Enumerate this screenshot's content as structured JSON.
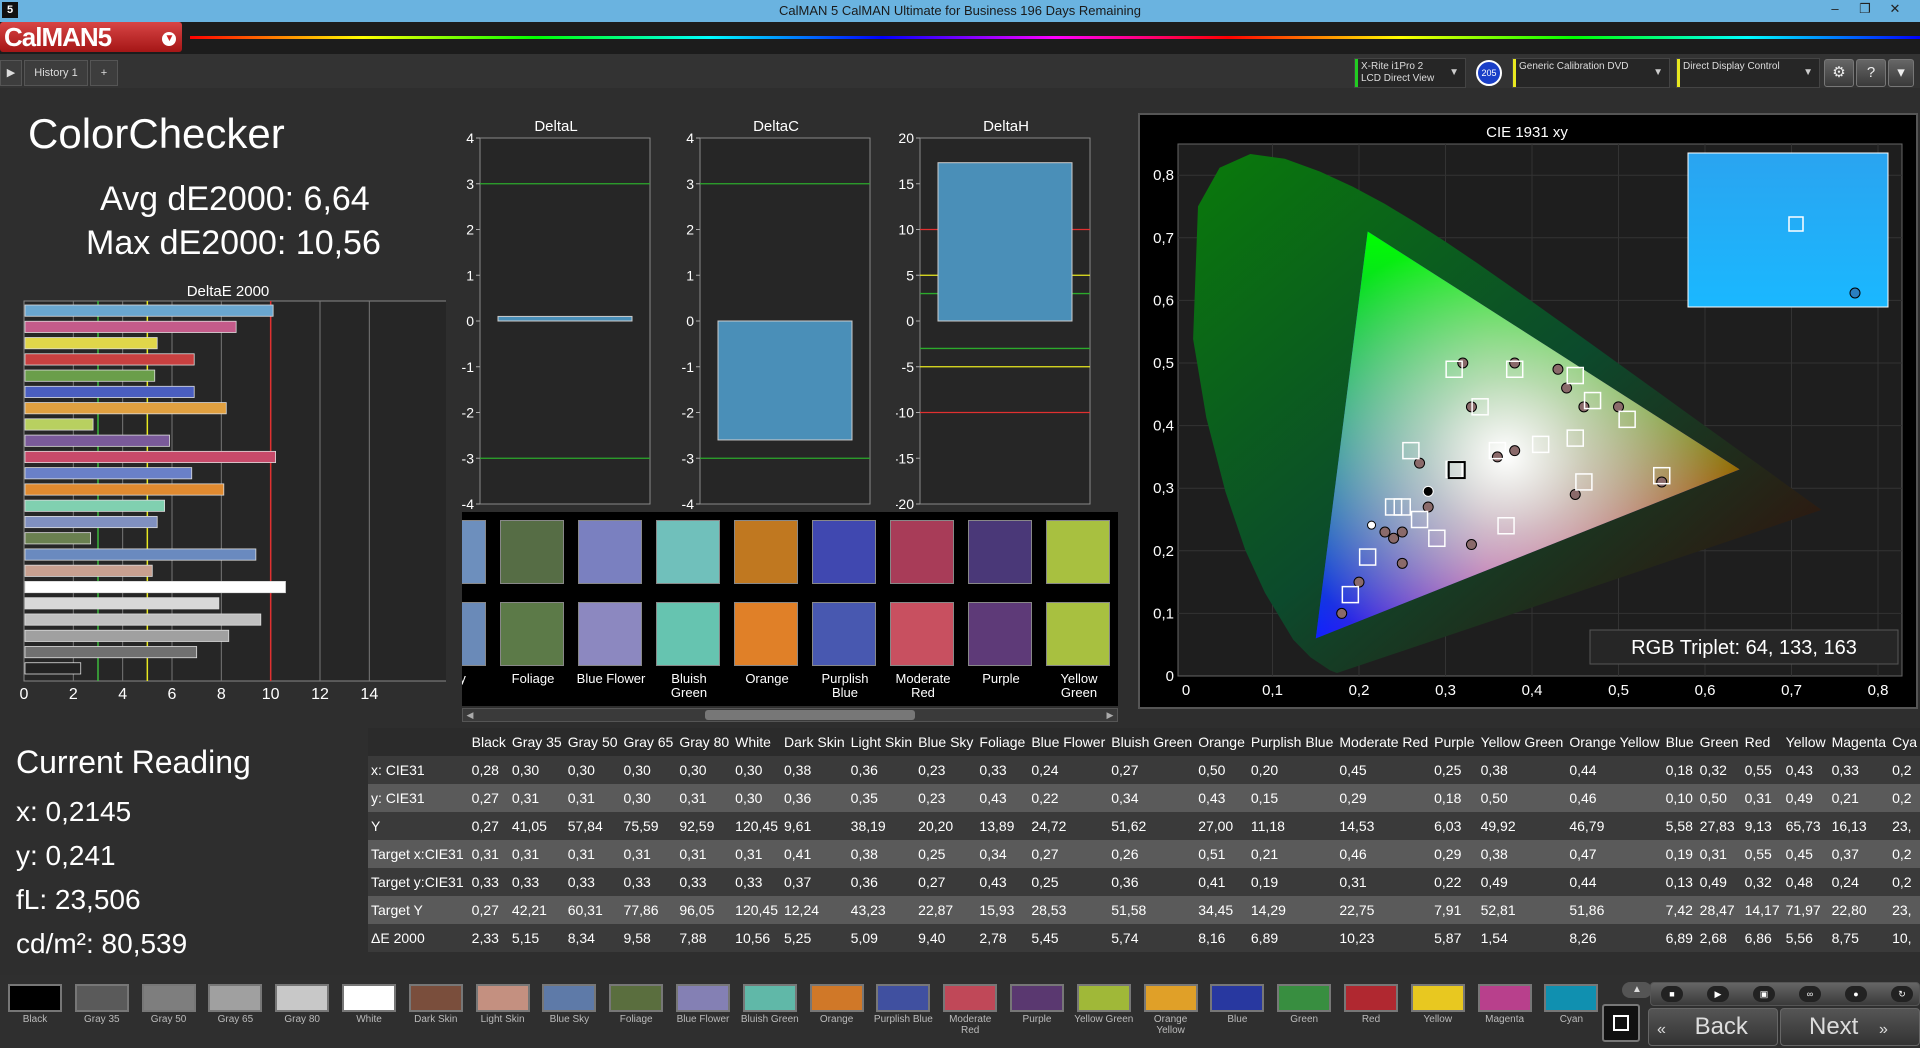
{
  "window": {
    "title": "CalMAN 5 CalMAN Ultimate for Business 196 Days Remaining",
    "icon": "5"
  },
  "app": {
    "logo": "CalMAN5",
    "tab": "History 1",
    "tab_add": "+"
  },
  "devices": {
    "meter": {
      "line1": "X-Rite i1Pro 2",
      "line2": "LCD Direct View",
      "badge": "205",
      "accent": "#22cc22"
    },
    "source": {
      "line1": "Generic Calibration DVD",
      "accent": "#e8e820"
    },
    "display": {
      "line1": "Direct Display Control",
      "accent": "#e8e820"
    }
  },
  "summary": {
    "title": "ColorChecker",
    "avg": "Avg dE2000: 6,64",
    "max": "Max dE2000: 10,56"
  },
  "deltae_chart": {
    "title": "DeltaE 2000",
    "ticks": [
      "0",
      "2",
      "4",
      "6",
      "8",
      "10",
      "12",
      "14"
    ],
    "values": [
      10.1,
      8.6,
      5.4,
      6.9,
      5.3,
      6.9,
      8.2,
      2.8,
      5.9,
      10.2,
      6.8,
      8.1,
      5.7,
      5.4,
      2.7,
      9.4,
      5.2,
      10.6,
      7.9,
      9.6,
      8.3,
      7.0,
      2.3
    ],
    "colors": [
      "#6aa7d0",
      "#c45b8a",
      "#e0d64a",
      "#c84040",
      "#6a9e4a",
      "#4a5ec0",
      "#e0a040",
      "#b8d060",
      "#7a5a9a",
      "#c84a6a",
      "#6a80c8",
      "#e08a30",
      "#80d0b0",
      "#8090c0",
      "#6a8050",
      "#6a8abf",
      "#c8a090",
      "#ffffff",
      "#d8d8d8",
      "#c0c0c0",
      "#a0a0a0",
      "#707070",
      "#222222"
    ],
    "lines": {
      "green": 3,
      "yellow": 5,
      "red": 10
    }
  },
  "deltaL": {
    "title": "DeltaL",
    "ticks": [
      "4",
      "3",
      "2",
      "1",
      "0",
      "-1",
      "-2",
      "-3",
      "-4"
    ],
    "value": 0.1
  },
  "deltaC": {
    "title": "DeltaC",
    "ticks": [
      "4",
      "3",
      "2",
      "1",
      "0",
      "-1",
      "-2",
      "-3",
      "-4"
    ],
    "value": -2.6
  },
  "deltaH": {
    "title": "DeltaH",
    "ticks": [
      "20",
      "15",
      "10",
      "5",
      "0",
      "-5",
      "-10",
      "-15",
      "-20"
    ],
    "value": 17.3
  },
  "swatch_strip": {
    "items": [
      {
        "name": "Sky",
        "actual": "#6d8fbd",
        "target": "#6a8ab8"
      },
      {
        "name": "Foliage",
        "actual": "#566d45",
        "target": "#5c7a48"
      },
      {
        "name": "Blue Flower",
        "actual": "#7a80c0",
        "target": "#8c88c0"
      },
      {
        "name": "Bluish Green",
        "actual": "#70c0bb",
        "target": "#66c4b0"
      },
      {
        "name": "Orange",
        "actual": "#c07820",
        "target": "#e08028"
      },
      {
        "name": "Purplish Blue",
        "actual": "#4048b0",
        "target": "#4858b0"
      },
      {
        "name": "Moderate Red",
        "actual": "#a83c58",
        "target": "#c85060"
      },
      {
        "name": "Purple",
        "actual": "#4a3878",
        "target": "#5e3a78"
      },
      {
        "name": "Yellow Green",
        "actual": "#a8c040",
        "target": "#a8c040"
      }
    ]
  },
  "cie": {
    "title": "CIE 1931 xy",
    "rgb_triplet": "RGB Triplet: 64, 133, 163",
    "xticks": [
      "0",
      "0,1",
      "0,2",
      "0,3",
      "0,4",
      "0,5",
      "0,6",
      "0,7",
      "0,8"
    ],
    "yticks": [
      "0,1",
      "0,2",
      "0,3",
      "0,4",
      "0,5",
      "0,6",
      "0,7",
      "0,8"
    ],
    "y_zero": "0",
    "targets": [
      [
        0.31,
        0.33
      ],
      [
        0.41,
        0.37
      ],
      [
        0.36,
        0.36
      ],
      [
        0.25,
        0.27
      ],
      [
        0.34,
        0.43
      ],
      [
        0.27,
        0.25
      ],
      [
        0.26,
        0.36
      ],
      [
        0.51,
        0.41
      ],
      [
        0.21,
        0.19
      ],
      [
        0.46,
        0.31
      ],
      [
        0.29,
        0.22
      ],
      [
        0.38,
        0.49
      ],
      [
        0.47,
        0.44
      ],
      [
        0.19,
        0.13
      ],
      [
        0.31,
        0.49
      ],
      [
        0.55,
        0.32
      ],
      [
        0.45,
        0.48
      ],
      [
        0.37,
        0.24
      ],
      [
        0.24,
        0.27
      ],
      [
        0.45,
        0.38
      ]
    ],
    "measured": [
      [
        0.28,
        0.27
      ],
      [
        0.38,
        0.36
      ],
      [
        0.36,
        0.35
      ],
      [
        0.23,
        0.23
      ],
      [
        0.33,
        0.43
      ],
      [
        0.24,
        0.22
      ],
      [
        0.27,
        0.34
      ],
      [
        0.5,
        0.43
      ],
      [
        0.2,
        0.15
      ],
      [
        0.45,
        0.29
      ],
      [
        0.25,
        0.18
      ],
      [
        0.38,
        0.5
      ],
      [
        0.44,
        0.46
      ],
      [
        0.18,
        0.1
      ],
      [
        0.32,
        0.5
      ],
      [
        0.55,
        0.31
      ],
      [
        0.43,
        0.49
      ],
      [
        0.33,
        0.21
      ],
      [
        0.25,
        0.23
      ],
      [
        0.46,
        0.43
      ]
    ],
    "current": [
      0.2145,
      0.241
    ]
  },
  "current_reading": {
    "title": "Current Reading",
    "x": "x: 0,2145",
    "y": "y: 0,241",
    "fl": "fL: 23,506",
    "cdm2": "cd/m²: 80,539"
  },
  "table": {
    "columns": [
      "",
      "Black",
      "Gray 35",
      "Gray 50",
      "Gray 65",
      "Gray 80",
      "White",
      "Dark Skin",
      "Light Skin",
      "Blue Sky",
      "Foliage",
      "Blue Flower",
      "Bluish Green",
      "Orange",
      "Purplish Blue",
      "Moderate Red",
      "Purple",
      "Yellow Green",
      "Orange Yellow",
      "Blue",
      "Green",
      "Red",
      "Yellow",
      "Magenta",
      "Cya"
    ],
    "rows": [
      [
        "x: CIE31",
        "0,28",
        "0,30",
        "0,30",
        "0,30",
        "0,30",
        "0,30",
        "0,38",
        "0,36",
        "0,23",
        "0,33",
        "0,24",
        "0,27",
        "0,50",
        "0,20",
        "0,45",
        "0,25",
        "0,38",
        "0,44",
        "0,18",
        "0,32",
        "0,55",
        "0,43",
        "0,33",
        "0,2"
      ],
      [
        "y: CIE31",
        "0,27",
        "0,31",
        "0,31",
        "0,30",
        "0,31",
        "0,30",
        "0,36",
        "0,35",
        "0,23",
        "0,43",
        "0,22",
        "0,34",
        "0,43",
        "0,15",
        "0,29",
        "0,18",
        "0,50",
        "0,46",
        "0,10",
        "0,50",
        "0,31",
        "0,49",
        "0,21",
        "0,2"
      ],
      [
        "Y",
        "0,27",
        "41,05",
        "57,84",
        "75,59",
        "92,59",
        "120,45",
        "9,61",
        "38,19",
        "20,20",
        "13,89",
        "24,72",
        "51,62",
        "27,00",
        "11,18",
        "14,53",
        "6,03",
        "49,92",
        "46,79",
        "5,58",
        "27,83",
        "9,13",
        "65,73",
        "16,13",
        "23,"
      ],
      [
        "Target x:CIE31",
        "0,31",
        "0,31",
        "0,31",
        "0,31",
        "0,31",
        "0,31",
        "0,41",
        "0,38",
        "0,25",
        "0,34",
        "0,27",
        "0,26",
        "0,51",
        "0,21",
        "0,46",
        "0,29",
        "0,38",
        "0,47",
        "0,19",
        "0,31",
        "0,55",
        "0,45",
        "0,37",
        "0,2"
      ],
      [
        "Target y:CIE31",
        "0,33",
        "0,33",
        "0,33",
        "0,33",
        "0,33",
        "0,33",
        "0,37",
        "0,36",
        "0,27",
        "0,43",
        "0,25",
        "0,36",
        "0,41",
        "0,19",
        "0,31",
        "0,22",
        "0,49",
        "0,44",
        "0,13",
        "0,49",
        "0,32",
        "0,48",
        "0,24",
        "0,2"
      ],
      [
        "Target Y",
        "0,27",
        "42,21",
        "60,31",
        "77,86",
        "96,05",
        "120,45",
        "12,24",
        "43,23",
        "22,87",
        "15,93",
        "28,53",
        "51,58",
        "34,45",
        "14,29",
        "22,75",
        "7,91",
        "52,81",
        "51,86",
        "7,42",
        "28,47",
        "14,17",
        "71,97",
        "22,80",
        "23,"
      ],
      [
        "ΔE 2000",
        "2,33",
        "5,15",
        "8,34",
        "9,58",
        "7,88",
        "10,56",
        "5,25",
        "5,09",
        "9,40",
        "2,78",
        "5,45",
        "5,74",
        "8,16",
        "6,89",
        "10,23",
        "5,87",
        "1,54",
        "8,26",
        "6,89",
        "2,68",
        "6,86",
        "5,56",
        "8,75",
        "10,"
      ]
    ]
  },
  "bottom_swatches": [
    {
      "name": "Black",
      "color": "#000000"
    },
    {
      "name": "Gray 35",
      "color": "#5a5a5a"
    },
    {
      "name": "Gray 50",
      "color": "#7e7e7e"
    },
    {
      "name": "Gray 65",
      "color": "#a0a0a0"
    },
    {
      "name": "Gray 80",
      "color": "#c8c8c8"
    },
    {
      "name": "White",
      "color": "#ffffff"
    },
    {
      "name": "Dark Skin",
      "color": "#7a4e3c"
    },
    {
      "name": "Light Skin",
      "color": "#c49080"
    },
    {
      "name": "Blue Sky",
      "color": "#5e7aa8"
    },
    {
      "name": "Foliage",
      "color": "#5a6e3e"
    },
    {
      "name": "Blue Flower",
      "color": "#8480b4"
    },
    {
      "name": "Bluish Green",
      "color": "#60b8a8"
    },
    {
      "name": "Orange",
      "color": "#d07828"
    },
    {
      "name": "Purplish Blue",
      "color": "#4050a0"
    },
    {
      "name": "Moderate Red",
      "color": "#c04858"
    },
    {
      "name": "Purple",
      "color": "#5a3870"
    },
    {
      "name": "Yellow Green",
      "color": "#a0b838"
    },
    {
      "name": "Orange Yellow",
      "color": "#e0a028"
    },
    {
      "name": "Blue",
      "color": "#2838a0"
    },
    {
      "name": "Green",
      "color": "#388e40"
    },
    {
      "name": "Red",
      "color": "#b02830"
    },
    {
      "name": "Yellow",
      "color": "#e8c820"
    },
    {
      "name": "Magenta",
      "color": "#b8408c"
    },
    {
      "name": "Cyan",
      "color": "#1090b0"
    }
  ],
  "nav": {
    "back": "Back",
    "next": "Next"
  }
}
